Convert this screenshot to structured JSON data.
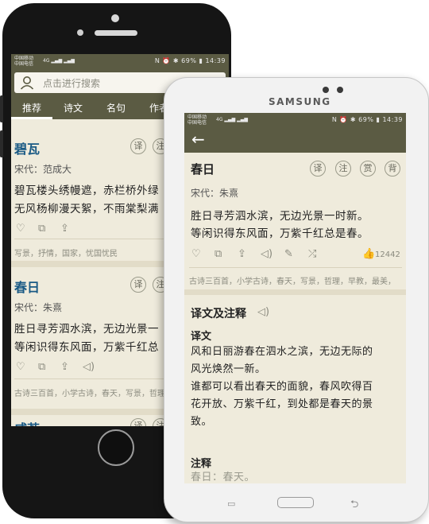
{
  "status": {
    "carrier1": "中国移动",
    "carrier2": "中国电信",
    "signal": "4G ▂▄▆ ▂▄▆",
    "right_icons": "N ⏰ ✱",
    "battery": "69%",
    "time": "14:39"
  },
  "phone": {
    "search_placeholder": "点击进行搜索",
    "tabs": [
      "推荐",
      "诗文",
      "名句",
      "作者"
    ],
    "cards": [
      {
        "title": "碧瓦",
        "author": "宋代：范成大",
        "lines": [
          "碧瓦楼头绣幔遮，赤栏桥外绿",
          "无风杨柳漫天絮，不雨棠梨满"
        ],
        "tags": "写景，抒情，国家，忧国忧民",
        "badges": [
          "译",
          "注"
        ]
      },
      {
        "title": "春日",
        "author": "宋代：朱熹",
        "lines": [
          "胜日寻芳泗水滨，无边光景一",
          "等闲识得东风面，万紫千红总"
        ],
        "tags": "古诗三百首，小学古诗，春天，写景，哲理",
        "badges": [
          "译",
          "注"
        ]
      },
      {
        "title": "咸若",
        "badges": [
          "译",
          "注"
        ]
      }
    ]
  },
  "tablet": {
    "brand": "SAMSUNG",
    "poem": {
      "title": "春日",
      "author": "宋代：朱熹",
      "lines": [
        "胜日寻芳泗水滨，无边光景一时新。",
        "等闲识得东风面，万紫千红总是春。"
      ],
      "badges": [
        "译",
        "注",
        "赏",
        "背"
      ],
      "like_count": "12442",
      "tags": "古诗三百首，小学古诗，春天，写景，哲理，早教，最美，"
    },
    "translation": {
      "section_title": "译文及注释",
      "subtitle_translation": "译文",
      "translation_lines": [
        "风和日丽游春在泗水之滨，无边无际的",
        "风光焕然一新。",
        "谁都可以看出春天的面貌，春风吹得百",
        "花开放、万紫千红，到处都是春天的景",
        "致。"
      ],
      "subtitle_notes": "注释",
      "notes_first": "春日：春天。"
    },
    "soft_keys": {
      "menu": "▭",
      "back": "⮌"
    }
  },
  "colors": {
    "header": "#5b5b43",
    "paper": "#efebdc",
    "title_blue": "#1a5a85"
  }
}
